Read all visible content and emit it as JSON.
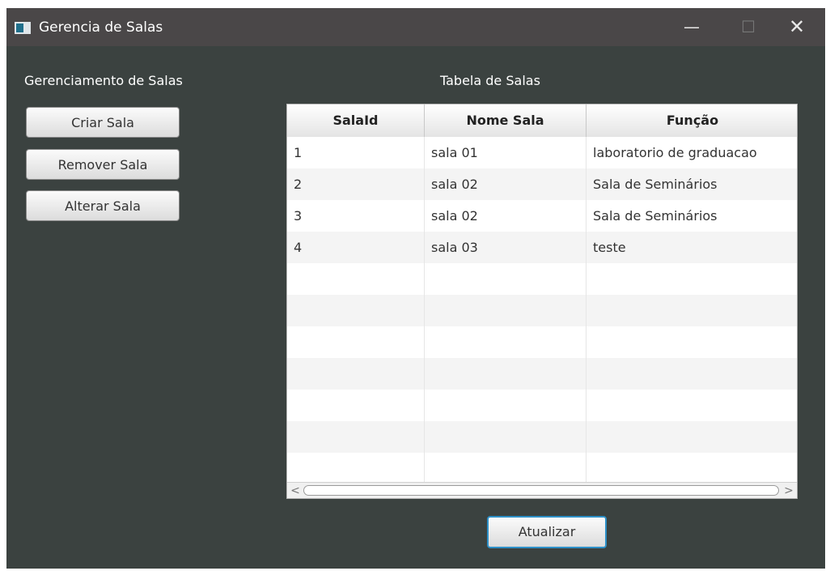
{
  "window": {
    "title": "Gerencia de Salas",
    "min_symbol": "—",
    "max_symbol": "☐",
    "close_symbol": "✕"
  },
  "left_panel": {
    "heading": "Gerenciamento de Salas",
    "buttons": [
      "Criar Sala",
      "Remover Sala",
      "Alterar Sala"
    ]
  },
  "table": {
    "heading": "Tabela de Salas",
    "columns": [
      "SalaId",
      "Nome Sala",
      "Função"
    ],
    "rows": [
      [
        "1",
        "sala 01",
        "laboratorio de graduacao"
      ],
      [
        "2",
        "sala 02",
        "Sala de Seminários"
      ],
      [
        "3",
        "sala 02",
        "Sala de Seminários"
      ],
      [
        "4",
        "sala 03",
        "teste"
      ]
    ],
    "scroll_left": "<",
    "scroll_right": ">"
  },
  "actions": {
    "refresh_label": "Atualizar"
  },
  "colors": {
    "background": "#3b4240",
    "titlebar": "#4a4748",
    "focus": "#2d90c8"
  }
}
